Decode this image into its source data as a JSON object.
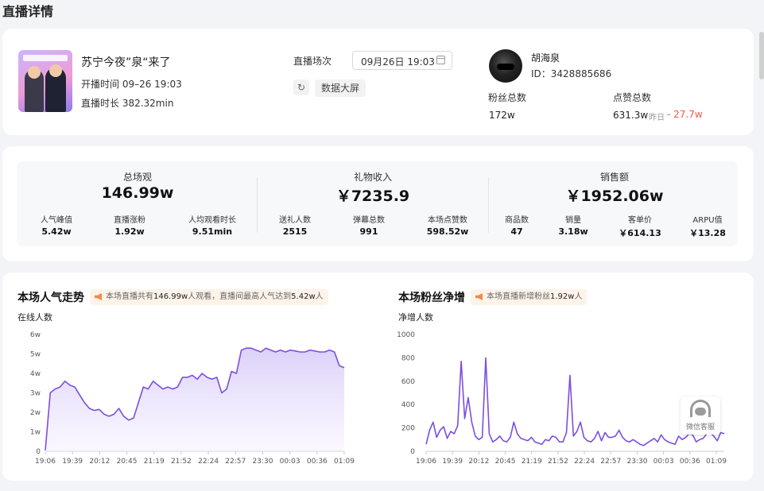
{
  "page": {
    "title": "直播详情"
  },
  "live": {
    "title": "苏宁今夜”泉“来了",
    "start_time": "开播时间 09–26 19:03",
    "duration": "直播时长 382.32min",
    "session_label": "直播场次",
    "session_value": "09月26日 19:03",
    "bigscreen_label": "数据大屏"
  },
  "host": {
    "name": "胡海泉",
    "id": "ID：3428885686",
    "fans_label": "粉丝总数",
    "fans_value": "172w",
    "likes_label": "点赞总数",
    "likes_value": "631.3w",
    "yesterday_label": "昨日",
    "likes_delta": "- 27.7w",
    "delta_color": "#f2594b"
  },
  "stats": [
    {
      "label": "总场观",
      "value": "146.99w",
      "sub": [
        {
          "label": "人气峰值",
          "value": "5.42w"
        },
        {
          "label": "直播涨粉",
          "value": "1.92w"
        },
        {
          "label": "人均观看时长",
          "value": "9.51min"
        }
      ]
    },
    {
      "label": "礼物收入",
      "value": "￥7235.9",
      "sub": [
        {
          "label": "送礼人数",
          "value": "2515"
        },
        {
          "label": "弹幕总数",
          "value": "991"
        },
        {
          "label": "本场点赞数",
          "value": "598.52w"
        }
      ]
    },
    {
      "label": "销售额",
      "value": "￥1952.06w",
      "sub": [
        {
          "label": "商品数",
          "value": "47"
        },
        {
          "label": "销量",
          "value": "3.18w"
        },
        {
          "label": "客单价",
          "value": "￥614.13"
        },
        {
          "label": "ARPU值",
          "value": "￥13.28"
        }
      ]
    }
  ],
  "popularity": {
    "title": "本场人气走势",
    "notice_a": "本场直播共有",
    "notice_total": "146.99w",
    "notice_b": "人观看，直播间最高人气达到",
    "notice_peak": "5.42w",
    "notice_c": "人"
  },
  "fans_net": {
    "title": "本场粉丝净增",
    "notice_a": "本场直播新增粉丝",
    "notice_total": "1.92w",
    "notice_c": "人"
  },
  "customer_service": {
    "label": "微信客服"
  },
  "colors": {
    "line": "#7b4fe0",
    "fill_top": "#d8ccf8",
    "fill_bottom": "#f6f2fe"
  },
  "chart_data": [
    {
      "type": "area",
      "title": "本场人气走势",
      "ylabel": "在线人数",
      "yticks": [
        "0",
        "1w",
        "2w",
        "3w",
        "4w",
        "5w",
        "6w"
      ],
      "ylim": [
        0,
        60000
      ],
      "categories": [
        "19:06",
        "19:39",
        "20:12",
        "20:45",
        "21:19",
        "21:52",
        "22:24",
        "22:57",
        "23:30",
        "00:03",
        "00:36",
        "01:09"
      ],
      "x": [
        "19:06",
        "19:12",
        "19:18",
        "19:24",
        "19:30",
        "19:36",
        "19:42",
        "19:48",
        "19:54",
        "20:00",
        "20:06",
        "20:12",
        "20:18",
        "20:24",
        "20:30",
        "20:36",
        "20:42",
        "20:48",
        "20:54",
        "21:00",
        "21:06",
        "21:12",
        "21:18",
        "21:24",
        "21:30",
        "21:36",
        "21:42",
        "21:48",
        "21:54",
        "22:00",
        "22:06",
        "22:12",
        "22:18",
        "22:24",
        "22:30",
        "22:36",
        "22:42",
        "22:48",
        "22:54",
        "23:00",
        "23:06",
        "23:12",
        "23:18",
        "23:24",
        "23:30",
        "23:36",
        "23:42",
        "23:48",
        "23:54",
        "00:00",
        "00:06",
        "00:12",
        "00:18",
        "00:24",
        "00:30",
        "00:36",
        "00:42",
        "00:48",
        "00:54",
        "01:00",
        "01:06",
        "01:12"
      ],
      "values": [
        500,
        30000,
        32000,
        33000,
        36000,
        34000,
        33000,
        29000,
        25000,
        22000,
        21000,
        21500,
        19000,
        18000,
        19000,
        22000,
        18000,
        16000,
        17000,
        25000,
        33000,
        32000,
        36000,
        34000,
        32000,
        33000,
        32000,
        33000,
        38000,
        38000,
        39000,
        37000,
        40000,
        38000,
        37000,
        38000,
        30000,
        32000,
        41000,
        40000,
        52000,
        53000,
        53000,
        52000,
        51000,
        53000,
        52000,
        51000,
        52000,
        51000,
        52000,
        51500,
        51000,
        51000,
        52000,
        51500,
        51000,
        51000,
        52000,
        51000,
        44000,
        43000
      ]
    },
    {
      "type": "line",
      "title": "本场粉丝净增",
      "ylabel": "净增人数",
      "yticks": [
        "0",
        "200",
        "400",
        "600",
        "800",
        "1000"
      ],
      "ylim": [
        0,
        1000
      ],
      "categories": [
        "19:06",
        "19:39",
        "20:12",
        "20:45",
        "21:19",
        "21:52",
        "22:24",
        "22:57",
        "23:30",
        "00:03",
        "00:36",
        "01:09"
      ],
      "values": [
        60,
        180,
        250,
        120,
        180,
        210,
        110,
        170,
        150,
        220,
        770,
        280,
        460,
        250,
        130,
        100,
        120,
        800,
        150,
        80,
        100,
        130,
        90,
        80,
        120,
        250,
        150,
        110,
        100,
        90,
        120,
        80,
        70,
        60,
        100,
        90,
        130,
        120,
        80,
        80,
        160,
        650,
        130,
        170,
        250,
        120,
        90,
        80,
        110,
        170,
        90,
        160,
        120,
        120,
        130,
        180,
        120,
        90,
        80,
        100,
        80,
        60,
        50,
        70,
        90,
        110,
        80,
        140,
        100,
        80,
        70,
        60,
        130,
        100,
        120,
        150,
        140,
        80,
        100,
        110,
        150,
        160,
        130,
        90,
        160,
        150
      ]
    }
  ]
}
